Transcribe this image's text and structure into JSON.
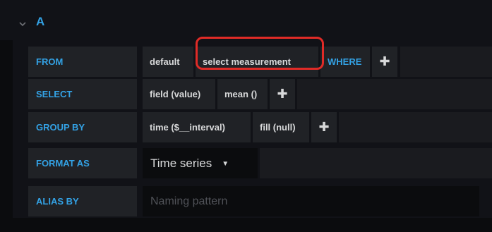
{
  "query": {
    "ref_id": "A",
    "collapse_icon": "chevron-down-icon"
  },
  "from": {
    "label": "FROM",
    "policy": "default",
    "measurement": "select measurement",
    "where_label": "WHERE",
    "add_icon": "plus-icon"
  },
  "select": {
    "label": "SELECT",
    "field": "field (value)",
    "aggregation": "mean ()",
    "add_icon": "plus-icon"
  },
  "group_by": {
    "label": "GROUP BY",
    "time": "time ($__interval)",
    "fill": "fill (null)",
    "add_icon": "plus-icon"
  },
  "format_as": {
    "label": "FORMAT AS",
    "selected": "Time series",
    "dropdown_icon": "caret-down-icon"
  },
  "alias_by": {
    "label": "ALIAS BY",
    "placeholder": "Naming pattern",
    "value": ""
  },
  "annotation": {
    "highlight_color": "#e02b27"
  },
  "colors": {
    "accent": "#33a2e5",
    "panel": "#202226",
    "background": "#0b0c0e"
  }
}
